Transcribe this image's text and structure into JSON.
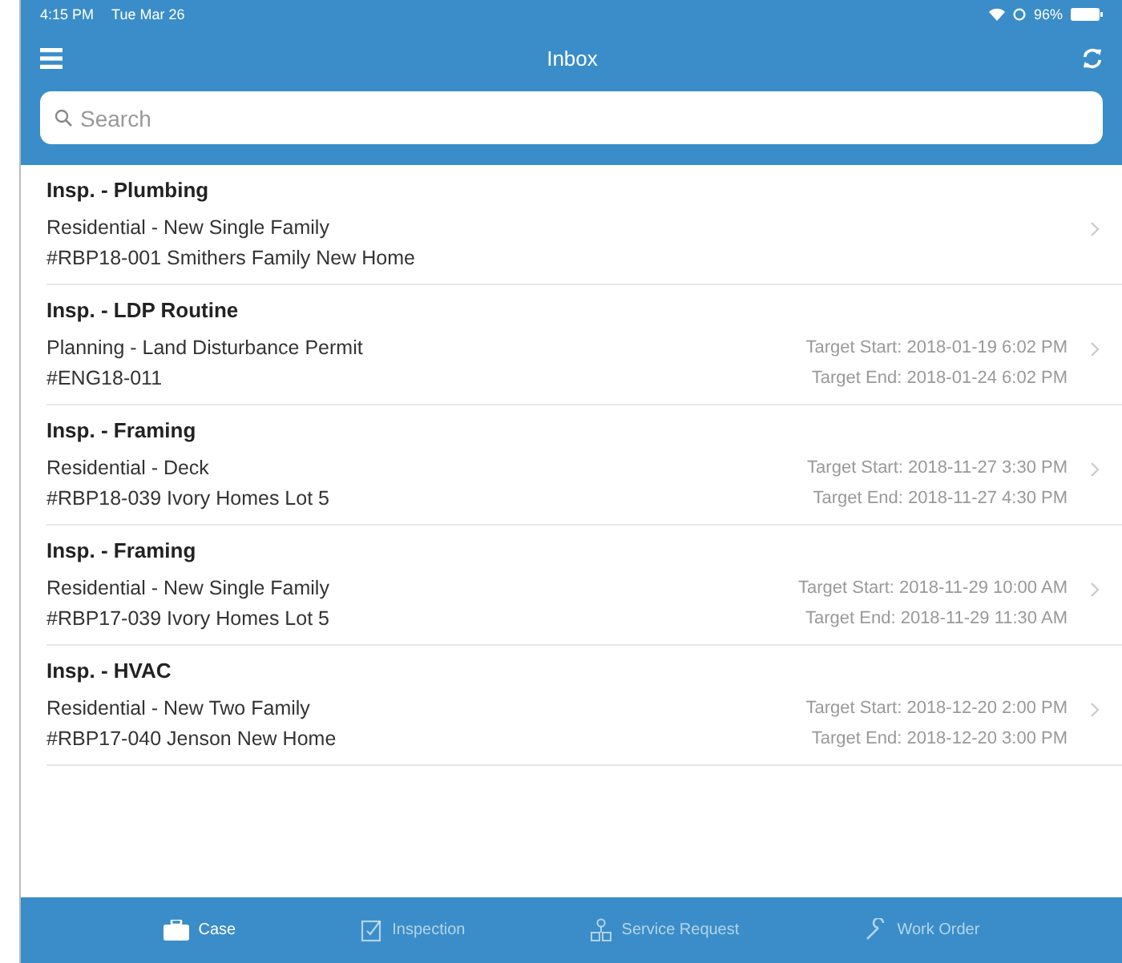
{
  "status_bar": {
    "time": "4:15 PM",
    "date": "Tue Mar 26",
    "battery": "96%"
  },
  "nav": {
    "title": "Inbox"
  },
  "search": {
    "placeholder": "Search"
  },
  "items": [
    {
      "title": "Insp. - Plumbing",
      "type": "Residential - New Single Family",
      "case": "#RBP18-001 Smithers Family New Home"
    },
    {
      "title": "Insp. - LDP Routine",
      "type": "Planning - Land Disturbance Permit",
      "case": "#ENG18-011",
      "start": "Target Start: 2018-01-19 6:02 PM",
      "end": "Target End: 2018-01-24 6:02 PM"
    },
    {
      "title": "Insp. - Framing",
      "type": "Residential - Deck",
      "case": "#RBP18-039 Ivory Homes Lot 5",
      "start": "Target Start: 2018-11-27 3:30 PM",
      "end": "Target End: 2018-11-27 4:30 PM"
    },
    {
      "title": "Insp. - Framing",
      "type": "Residential - New Single Family",
      "case": "#RBP17-039 Ivory Homes Lot 5",
      "start": "Target Start: 2018-11-29 10:00 AM",
      "end": "Target End: 2018-11-29 11:30 AM"
    },
    {
      "title": "Insp. - HVAC",
      "type": "Residential - New Two Family",
      "case": "#RBP17-040 Jenson New Home",
      "start": "Target Start: 2018-12-20 2:00 PM",
      "end": "Target End: 2018-12-20 3:00 PM"
    }
  ],
  "tabs": [
    {
      "label": "Case",
      "kind": "case",
      "selected": true
    },
    {
      "label": "Inspection",
      "kind": "inspection",
      "selected": false
    },
    {
      "label": "Service Request",
      "kind": "service",
      "selected": false
    },
    {
      "label": "Work Order",
      "kind": "work",
      "selected": false
    }
  ]
}
